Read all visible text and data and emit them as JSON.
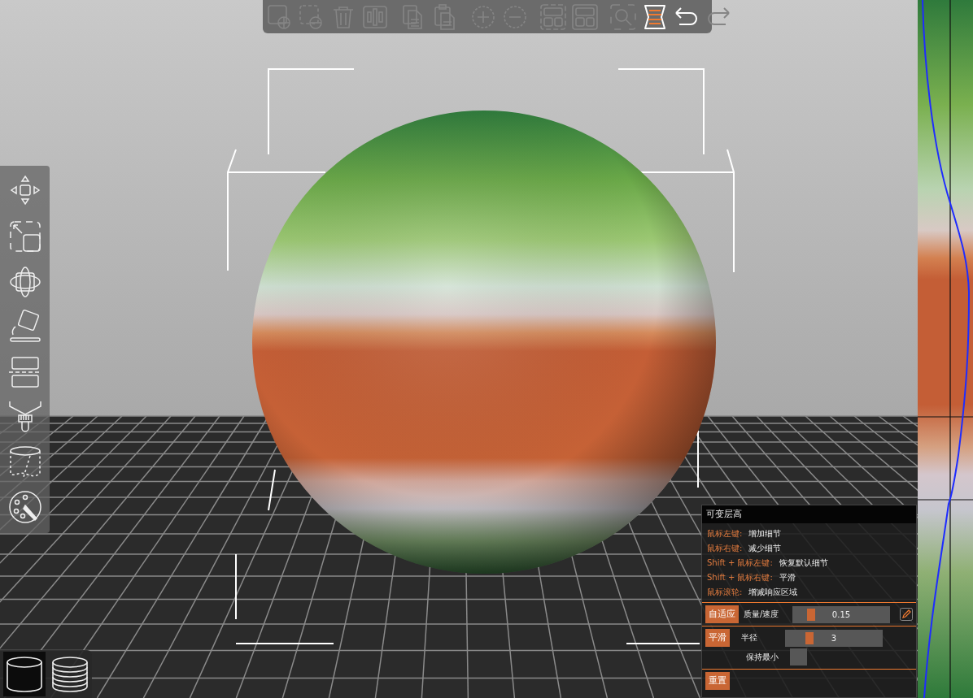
{
  "toolbar": [
    {
      "kind": "add",
      "disabled": true,
      "selected": false
    },
    {
      "kind": "remove-part",
      "disabled": true,
      "selected": false
    },
    {
      "kind": "delete",
      "disabled": true,
      "selected": false
    },
    {
      "kind": "arrange",
      "disabled": true,
      "selected": false
    },
    {
      "kind": "copy",
      "disabled": true,
      "selected": false
    },
    {
      "kind": "paste",
      "disabled": true,
      "selected": false
    },
    {
      "kind": "plus",
      "disabled": true,
      "selected": false
    },
    {
      "kind": "minus",
      "disabled": true,
      "selected": false
    },
    {
      "kind": "split-objects",
      "disabled": true,
      "selected": false
    },
    {
      "kind": "split-parts",
      "disabled": true,
      "selected": false
    },
    {
      "kind": "zoom",
      "disabled": true,
      "selected": false
    },
    {
      "kind": "layer-height",
      "disabled": false,
      "selected": true
    },
    {
      "kind": "undo",
      "disabled": false,
      "selected": false
    },
    {
      "kind": "redo",
      "disabled": true,
      "selected": false
    }
  ],
  "view_buttons": [
    {
      "kind": "single",
      "selected": true
    },
    {
      "kind": "layers",
      "selected": false
    }
  ],
  "panel": {
    "title": "可变层高",
    "hints": [
      {
        "key": "鼠标左键:",
        "action": "增加细节"
      },
      {
        "key": "鼠标右键:",
        "action": "减少细节"
      },
      {
        "key": "Shift + 鼠标左键:",
        "action": "恢复默认细节"
      },
      {
        "key": "Shift + 鼠标右键:",
        "action": "平滑"
      },
      {
        "key": "鼠标滚轮:",
        "action": "增减响应区域"
      }
    ],
    "adaptive": {
      "button": "自适应",
      "label": "质量/速度",
      "value": "0.15",
      "level": 0.16
    },
    "smooth": {
      "button": "平滑",
      "label": "半径",
      "value": "3",
      "level": 0.23
    },
    "keep_min": {
      "label": "保持最小",
      "checked": false
    },
    "reset": {
      "button": "重置"
    }
  }
}
